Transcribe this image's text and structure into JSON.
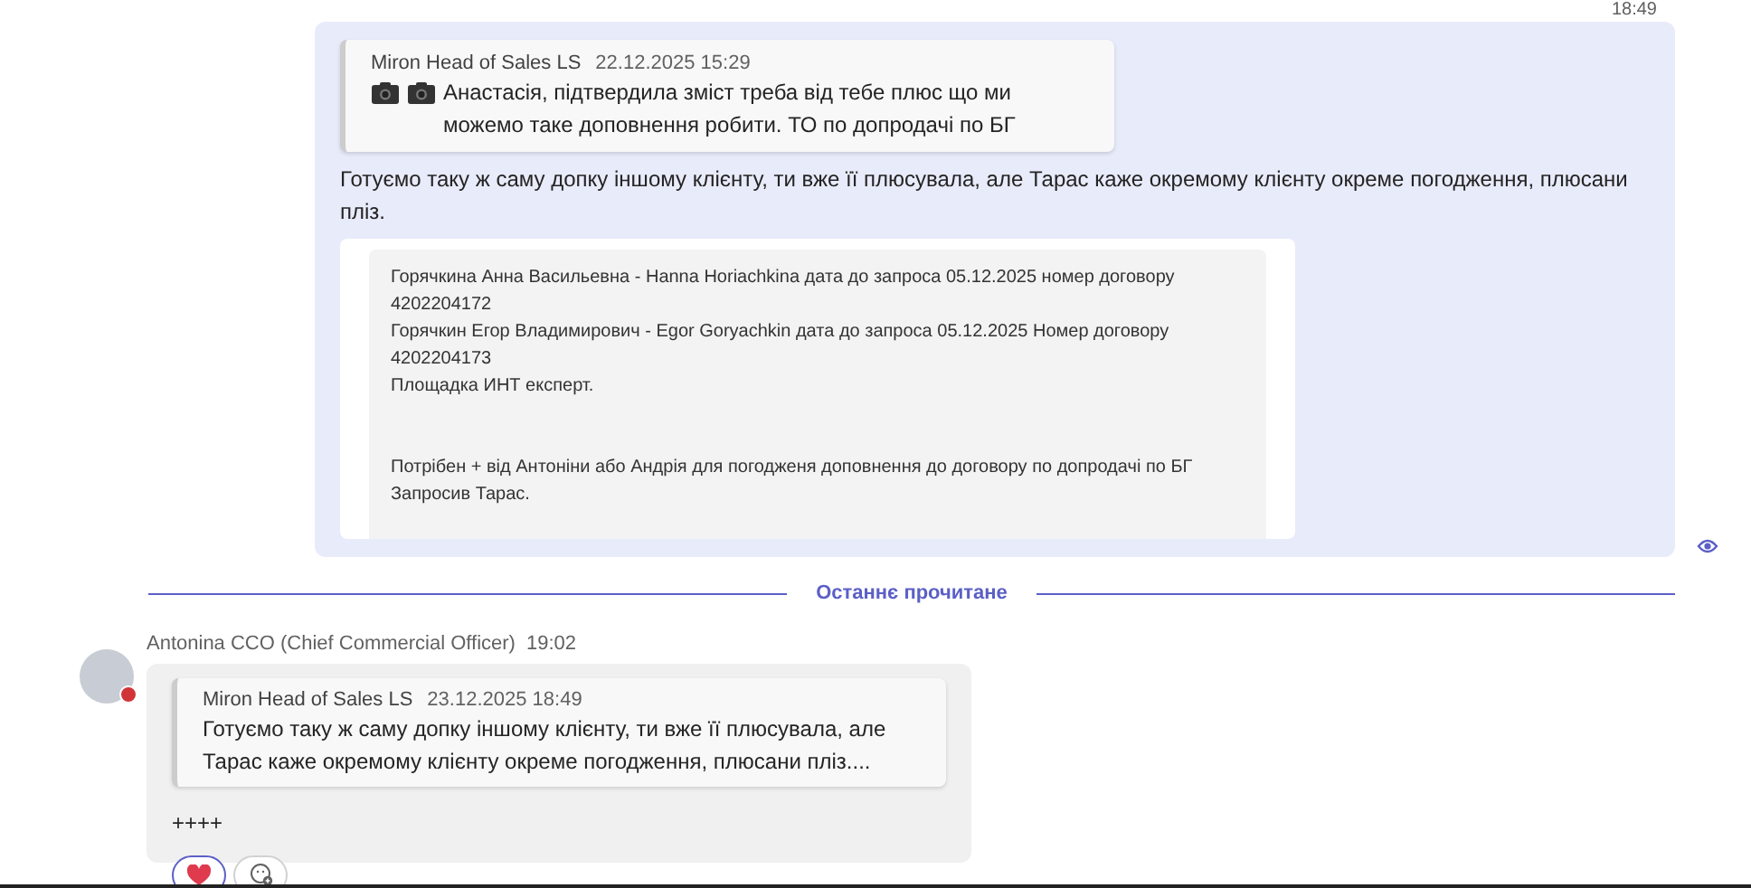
{
  "sent_message": {
    "time": "18:49",
    "quote": {
      "author": "Miron Head of Sales LS",
      "timestamp": "22.12.2025 15:29",
      "text": "Анастасія, підтвердила зміст треба від тебе плюс що ми можемо таке доповнення робити. ТО по допродачі по БГ"
    },
    "text": "Готуємо таку ж саму допку іншому клієнту, ти вже її плюсувала, але Тарас каже окремому клієнту окреме погодження, плюсани пліз.",
    "attachment": {
      "paragraphs": [
        [
          "Горячкина Анна Васильевна - Hanna Horiachkina дата до запроса 05.12.2025 номер договору 4202204172",
          "Горячкин Егор Владимирович - Egor  Goryachkin дата до запроса 05.12.2025 Номер договору 4202204173",
          "Площадка ИНТ експерт."
        ],
        [
          "Потрібен + від Антоніни або Андрія для погодженя доповнення до договору по допродачі по БГ",
          "Запросив Тарас."
        ]
      ]
    },
    "seen": true
  },
  "divider": {
    "label": "Останнє прочитане"
  },
  "received_message": {
    "author": "Antonina CCO (Chief Commercial Officer)",
    "time": "19:02",
    "quote": {
      "author": "Miron Head of Sales LS",
      "timestamp": "23.12.2025 18:49",
      "text": "Готуємо таку ж саму допку іншому клієнту, ти вже її плюсувала, але Тарас каже окремому клієнту окреме погодження, плюсани пліз...."
    },
    "text": "++++",
    "reactions": [
      {
        "kind": "heart",
        "selected": true
      },
      {
        "kind": "add",
        "selected": false
      }
    ]
  }
}
